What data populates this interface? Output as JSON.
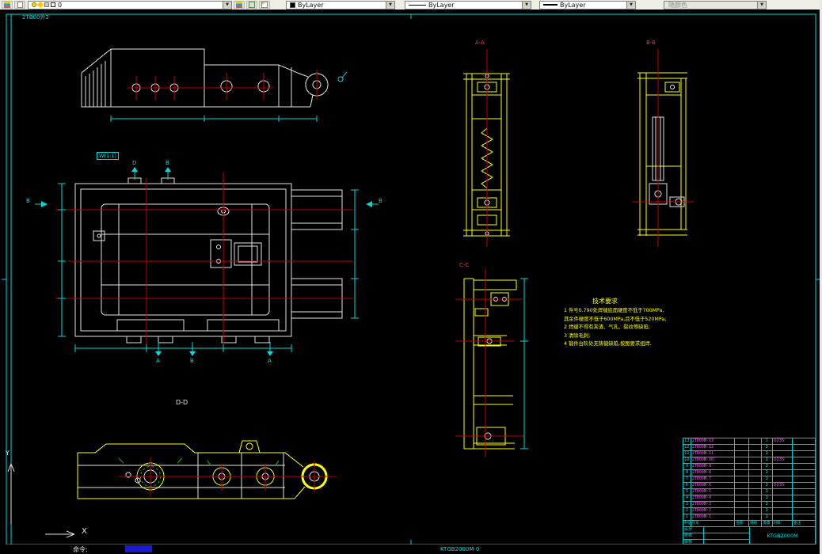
{
  "toolbar": {
    "layer_value": "0",
    "color_value": "ByLayer",
    "linetype_value": "ByLayer",
    "lineweight_value": "ByLayer",
    "plot_style_value": "随颜色"
  },
  "icons": {
    "dropdown": "▼"
  },
  "colors": {
    "cyan": "#00d8d8",
    "yellow": "#ffff00",
    "magenta": "#ff50ff",
    "red": "#c00000",
    "white": "#e2e2e2",
    "green": "#00b400"
  },
  "canvas": {
    "sheet_label": "2TB00外2",
    "labels": {
      "aa": "A-A",
      "bb": "B-B",
      "cc": "C-C",
      "dd": "D-D",
      "w": "W(1:1)"
    },
    "section_marks": {
      "top_d": "D",
      "top_b": "B",
      "left_b": "B",
      "right_b": "B",
      "bottom_a1": "A",
      "bottom_b": "B",
      "bottom_a2": "A"
    },
    "ucs": {
      "x": "X",
      "y": "Y"
    }
  },
  "notes": {
    "title": "技术要求",
    "items": [
      "1 件号0.790处焊缝底面硬度不低于700MPa,",
      "  其余件硬度不低于600MPa,且不低于520MPa;",
      "2 焊缝不得有夹渣、气孔、裂纹等缺陷;",
      "3 清除毛刺;",
      "4 锻件台阶处无铸锻缺陷,按图要求组焊."
    ]
  },
  "table": {
    "header": [
      "序号",
      "代号",
      "名称",
      "规格",
      "数量",
      "材料",
      "备注"
    ],
    "rows": [
      {
        "no": "13",
        "code": "2TB00M-13",
        "qty": "1",
        "material": "Q235"
      },
      {
        "no": "12",
        "code": "2TB00M-12",
        "qty": "2",
        "material": ""
      },
      {
        "no": "11",
        "code": "2TB00M-11",
        "qty": "1",
        "material": ""
      },
      {
        "no": "10",
        "code": "2TB00M-10",
        "qty": "1",
        "material": "Q235"
      },
      {
        "no": "9",
        "code": "2TB00M-9",
        "qty": "2",
        "material": ""
      },
      {
        "no": "8",
        "code": "2TB00M-8",
        "qty": "1",
        "material": ""
      },
      {
        "no": "7",
        "code": "2TB00M-7",
        "qty": "1",
        "material": ""
      },
      {
        "no": "6",
        "code": "2TB00M-6",
        "qty": "2",
        "material": "Q235"
      },
      {
        "no": "5",
        "code": "2TB00M-5",
        "qty": "1",
        "material": ""
      },
      {
        "no": "4",
        "code": "2TB00M-4",
        "qty": "1",
        "material": ""
      },
      {
        "no": "3",
        "code": "2TB00M-3",
        "qty": "2",
        "material": ""
      },
      {
        "no": "2",
        "code": "2TB00M-2",
        "qty": "1",
        "material": ""
      },
      {
        "no": "1",
        "code": "2TB00M-1",
        "qty": "1",
        "material": ""
      }
    ],
    "title_block": {
      "left_rows": [
        "设计",
        "校核",
        "审核"
      ],
      "code": "KTGB2000M"
    }
  },
  "status": {
    "command": "命令:",
    "code": "KTGB2000M-0"
  }
}
